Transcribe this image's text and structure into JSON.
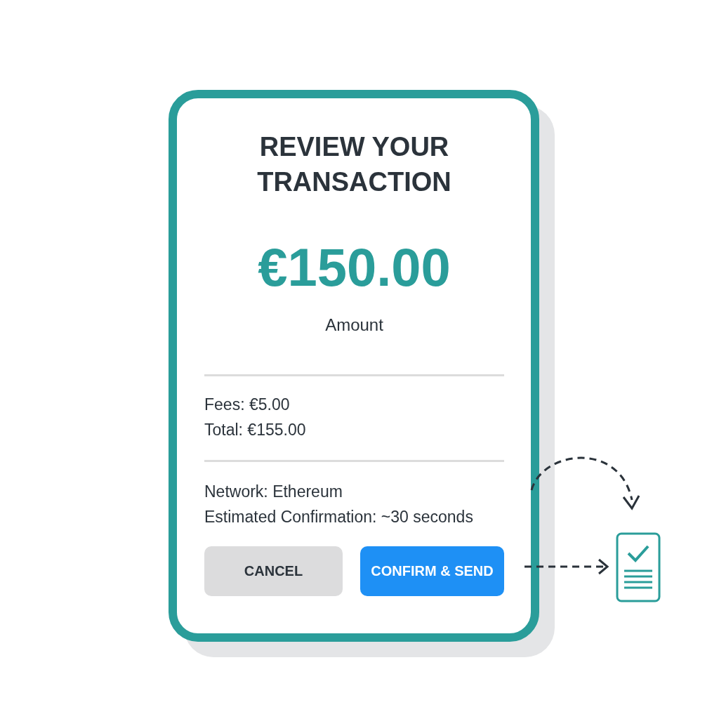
{
  "title": "REVIEW YOUR TRANSACTION",
  "amount": "€150.00",
  "amount_label": "Amount",
  "fees": "Fees: €5.00",
  "total": "Total: €155.00",
  "network": "Network: Ethereum",
  "confirmation": "Estimated Confirmation: ~30 seconds",
  "buttons": [
    {
      "label": "CANCEL",
      "kind": "secondary"
    },
    {
      "label": "CONFIRM & SEND",
      "kind": "primary"
    }
  ]
}
